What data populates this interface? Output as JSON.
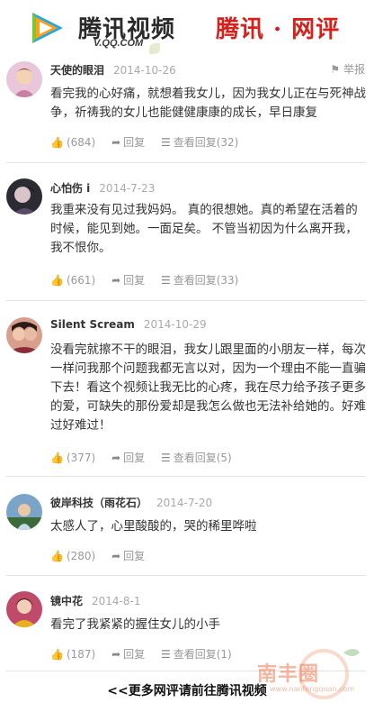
{
  "header": {
    "logo_text": "腾讯视频",
    "logo_url": "V.QQ.COM",
    "right_title": "腾讯 · 网评"
  },
  "comments": [
    {
      "user": "天使的眼泪",
      "date": "2014-10-26",
      "report": "举报",
      "text": "看完我的心好痛，就想着我女儿，因为我女儿正在与死神战争，祈祷我的女儿也能健健康康的成长，早日康复",
      "likes": "(684)",
      "reply": "回复",
      "view_replies": "查看回复(32)"
    },
    {
      "user": "心怕伤 i",
      "date": "2014-7-23",
      "text": "我重来没有见过我妈妈。 真的很想她。真的希望在活着的时候，能见到她。一面足矣。 不管当初因为什么离开我，我不恨你。",
      "likes": "(661)",
      "reply": "回复",
      "view_replies": "查看回复(33)"
    },
    {
      "user": "Silent Scream",
      "date": "2014-10-29",
      "text": "没看完就擦不干的眼泪，我女儿跟里面的小朋友一样，每次一样问我那个问题我都无言以对，因为一个理由不能一直骗下去！看这个视频让我无比的心疼，我在尽力给予孩子更多的爱，可缺失的那份爱却是我怎么做也无法补给她的。好难过好难过！",
      "likes": "(377)",
      "reply": "回复",
      "view_replies": "查看回复(5)"
    },
    {
      "user": "彼岸科技（雨花石）",
      "date": "2014-7-20",
      "text": "太感人了，心里酸酸的，哭的稀里哗啦",
      "likes": "(280)",
      "reply": "回复"
    },
    {
      "user": "镜中花",
      "date": "2014-8-1",
      "text": "看完了我紧紧的握住女儿的小手",
      "likes": "(187)",
      "reply": "回复",
      "view_replies": "查看回复(1)"
    }
  ],
  "footer": {
    "link": "<<更多网评请前往腾讯视频"
  },
  "watermark": {
    "text": "南丰圈",
    "url": "www.nanfengquan.com"
  },
  "colors": {
    "brand_red": "#d6201c",
    "muted": "#999999",
    "divider": "#e3e3e3"
  }
}
